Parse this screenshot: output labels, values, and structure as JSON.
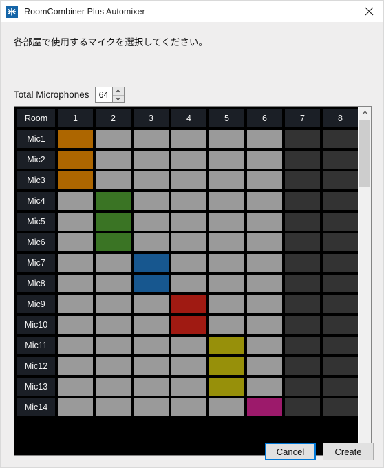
{
  "window": {
    "title": "RoomCombiner Plus Automixer",
    "icon": "automixer-icon",
    "close_icon": "close-icon"
  },
  "instruction": "各部屋で使用するマイクを選択してください。",
  "total_microphones": {
    "label": "Total Microphones",
    "value": "64",
    "up_icon": "spinner-up-icon",
    "down_icon": "spinner-down-icon"
  },
  "grid": {
    "corner_header": "Room",
    "column_headers": [
      "1",
      "2",
      "3",
      "4",
      "5",
      "6",
      "7",
      "8"
    ],
    "enabled_columns": 6,
    "row_labels": [
      "Mic1",
      "Mic2",
      "Mic3",
      "Mic4",
      "Mic5",
      "Mic6",
      "Mic7",
      "Mic8",
      "Mic9",
      "Mic10",
      "Mic11",
      "Mic12",
      "Mic13",
      "Mic14"
    ],
    "colors": {
      "unassigned": "#9a9a9a",
      "disabled": "#333333",
      "room1": "#ad6600",
      "room2": "#3a7424",
      "room3": "#17578f",
      "room4": "#a01a12",
      "room5": "#97900a",
      "room6": "#9c1a6b",
      "grid_background": "#000000",
      "header_background": "#1b1f26"
    },
    "assignments": [
      {
        "row": "Mic1",
        "column": "1",
        "color": "#ad6600"
      },
      {
        "row": "Mic2",
        "column": "1",
        "color": "#ad6600"
      },
      {
        "row": "Mic3",
        "column": "1",
        "color": "#ad6600"
      },
      {
        "row": "Mic4",
        "column": "2",
        "color": "#3a7424"
      },
      {
        "row": "Mic5",
        "column": "2",
        "color": "#3a7424"
      },
      {
        "row": "Mic6",
        "column": "2",
        "color": "#3a7424"
      },
      {
        "row": "Mic7",
        "column": "3",
        "color": "#17578f"
      },
      {
        "row": "Mic8",
        "column": "3",
        "color": "#17578f"
      },
      {
        "row": "Mic9",
        "column": "4",
        "color": "#a01a12"
      },
      {
        "row": "Mic10",
        "column": "4",
        "color": "#a01a12"
      },
      {
        "row": "Mic11",
        "column": "5",
        "color": "#97900a"
      },
      {
        "row": "Mic12",
        "column": "5",
        "color": "#97900a"
      },
      {
        "row": "Mic13",
        "column": "5",
        "color": "#97900a"
      },
      {
        "row": "Mic14",
        "column": "6",
        "color": "#9c1a6b"
      }
    ]
  },
  "scrollbar": {
    "up_icon": "chevron-up-icon",
    "down_icon": "chevron-down-icon",
    "thumb_position": "top"
  },
  "footer": {
    "cancel_label": "Cancel",
    "create_label": "Create",
    "focused_button": "Cancel",
    "focus_color": "#0078d7"
  }
}
